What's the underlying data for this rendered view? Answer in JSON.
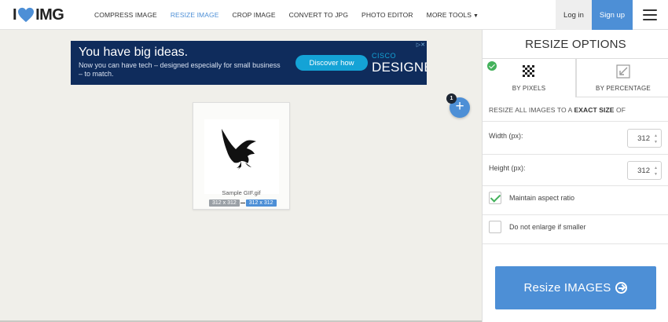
{
  "header": {
    "logo": {
      "left": "I",
      "right": "IMG"
    },
    "nav": [
      {
        "label": "COMPRESS IMAGE",
        "active": false
      },
      {
        "label": "RESIZE IMAGE",
        "active": true
      },
      {
        "label": "CROP IMAGE",
        "active": false
      },
      {
        "label": "CONVERT TO JPG",
        "active": false
      },
      {
        "label": "PHOTO EDITOR",
        "active": false
      },
      {
        "label": "MORE TOOLS",
        "active": false
      }
    ],
    "login_label": "Log in",
    "signup_label": "Sign up",
    "menu_icon": "hamburger-icon"
  },
  "ad": {
    "headline": "You have big ideas.",
    "sub": "Now you can have tech – designed especially for small business – to match.",
    "cta": "Discover how",
    "brand_top": "CISCO",
    "brand_bottom": "DESIGNED"
  },
  "file": {
    "name": "Sample GIF.gif",
    "original_size": "312 x 312",
    "new_size": "312 x 312",
    "count_badge": "1"
  },
  "panel": {
    "title": "RESIZE OPTIONS",
    "tabs": [
      {
        "label": "BY PIXELS",
        "selected": true,
        "icon": "pixels-icon"
      },
      {
        "label": "BY PERCENTAGE",
        "selected": false,
        "icon": "percentage-resize-icon"
      }
    ],
    "description_prefix": "RESIZE ALL IMAGES TO A",
    "description_bold": "EXACT SIZE",
    "description_suffix": "OF",
    "width_label": "Width (px):",
    "width_value": "312",
    "height_label": "Height (px):",
    "height_value": "312",
    "maintain_aspect_label": "Maintain aspect ratio",
    "maintain_aspect_checked": true,
    "no_enlarge_label": "Do not enlarge if smaller",
    "no_enlarge_checked": false,
    "submit_label": "Resize IMAGES"
  },
  "colors": {
    "accent": "#4d8fd6",
    "brand_red": "#e5322d",
    "check_green": "#43b15b",
    "background": "#f0efea"
  }
}
